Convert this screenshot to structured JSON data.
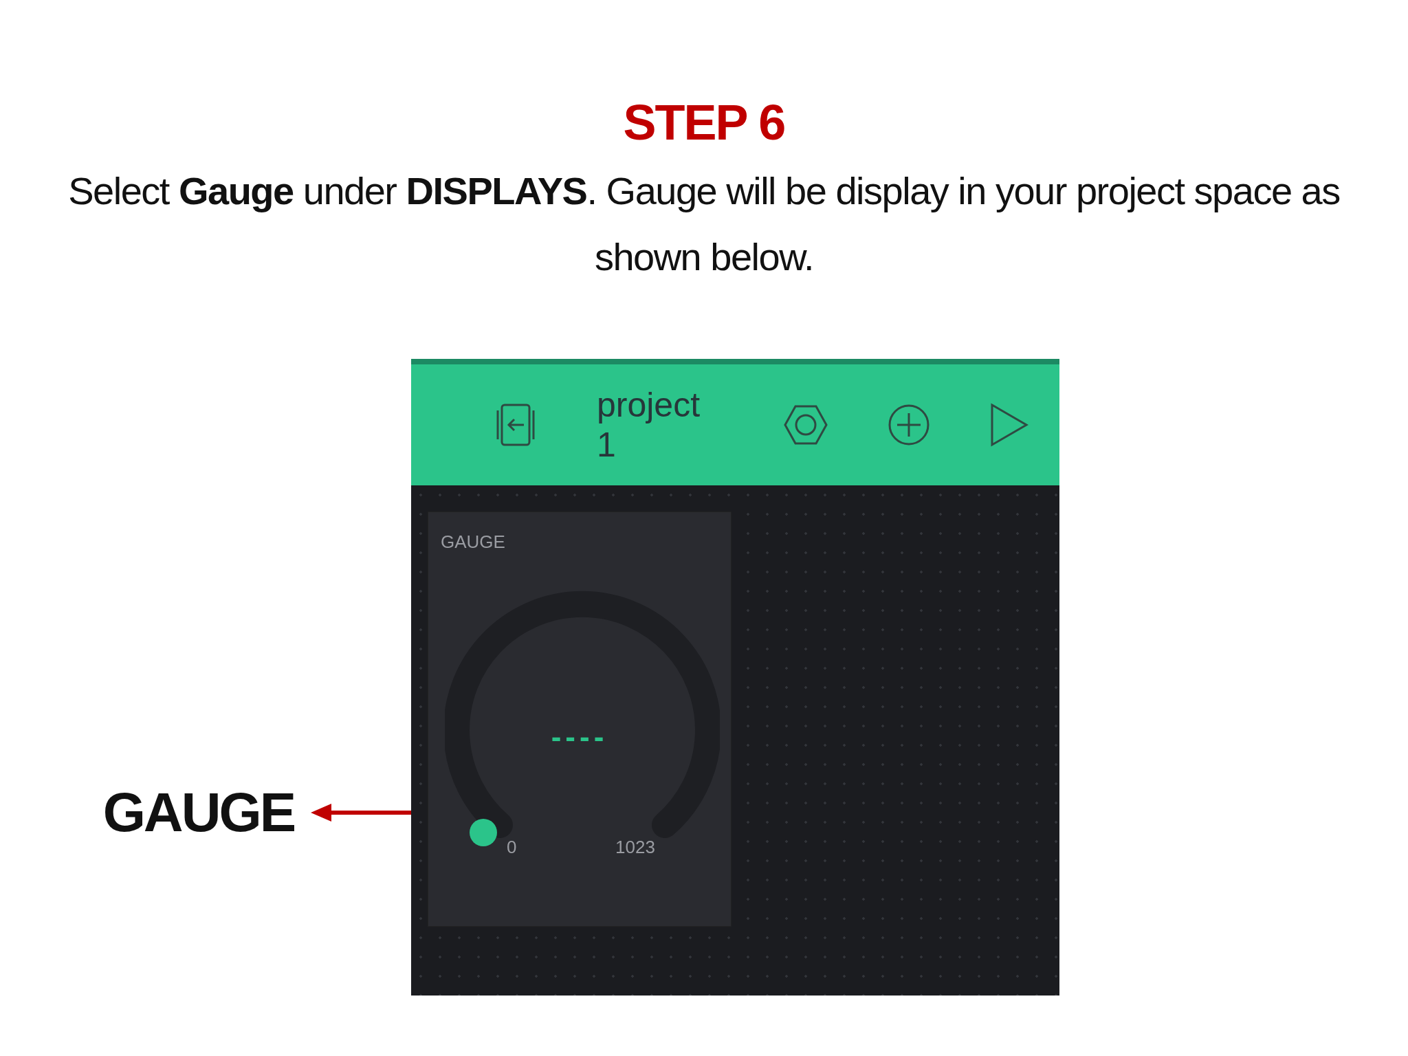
{
  "title": "STEP 6",
  "instruction": "Select **Gauge** under **DISPLAYS**. Gauge will be display in your project space as shown below.",
  "callout": {
    "label": "GAUGE"
  },
  "app": {
    "header": {
      "title": "project 1"
    },
    "widget": {
      "title": "GAUGE",
      "value": "----",
      "min": "0",
      "max": "1023"
    }
  }
}
